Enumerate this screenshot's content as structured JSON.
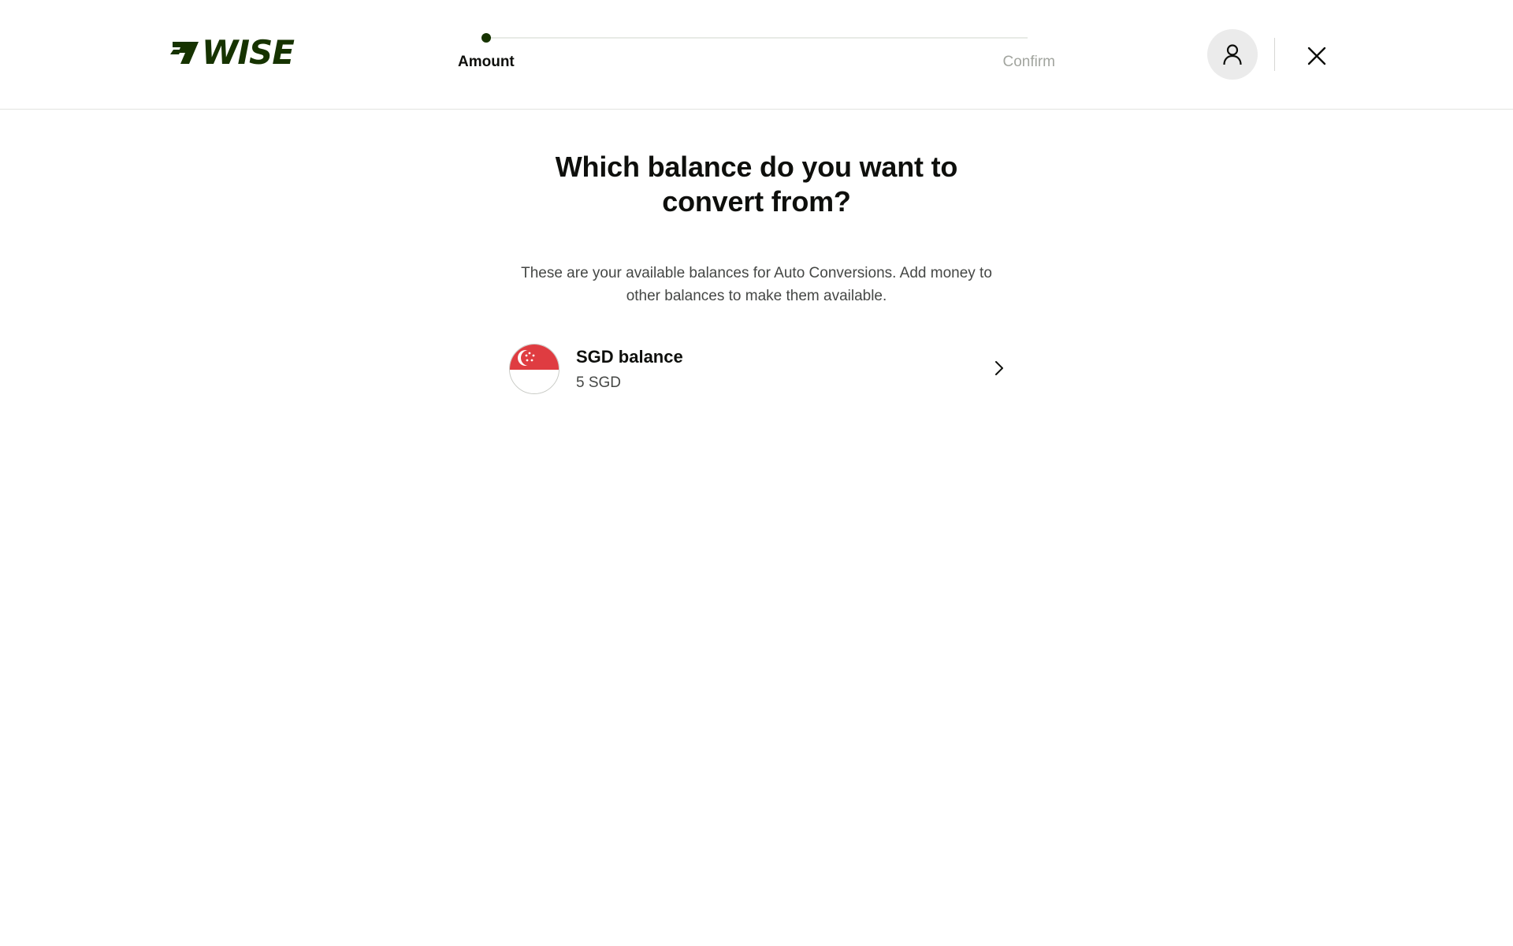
{
  "header": {
    "logo_text": "WISE",
    "steps": [
      {
        "label": "Amount",
        "active": true
      },
      {
        "label": "Confirm",
        "active": false
      }
    ],
    "progress": 0,
    "profile_icon": "user-icon",
    "close_icon": "close-icon"
  },
  "main": {
    "title": "Which balance do you want to convert from?",
    "subtitle": "These are your available balances for Auto Conversions. Add money to other balances to make them available.",
    "balances": [
      {
        "name": "SGD balance",
        "amount": "5 SGD",
        "flag_icon": "singapore-flag-icon",
        "chevron_icon": "chevron-right-icon"
      }
    ]
  },
  "colors": {
    "brand": "#163300",
    "flag_red": "#df3c41",
    "text_primary": "#0e0f0c",
    "text_secondary": "#454745",
    "text_muted": "#a2a59f"
  }
}
